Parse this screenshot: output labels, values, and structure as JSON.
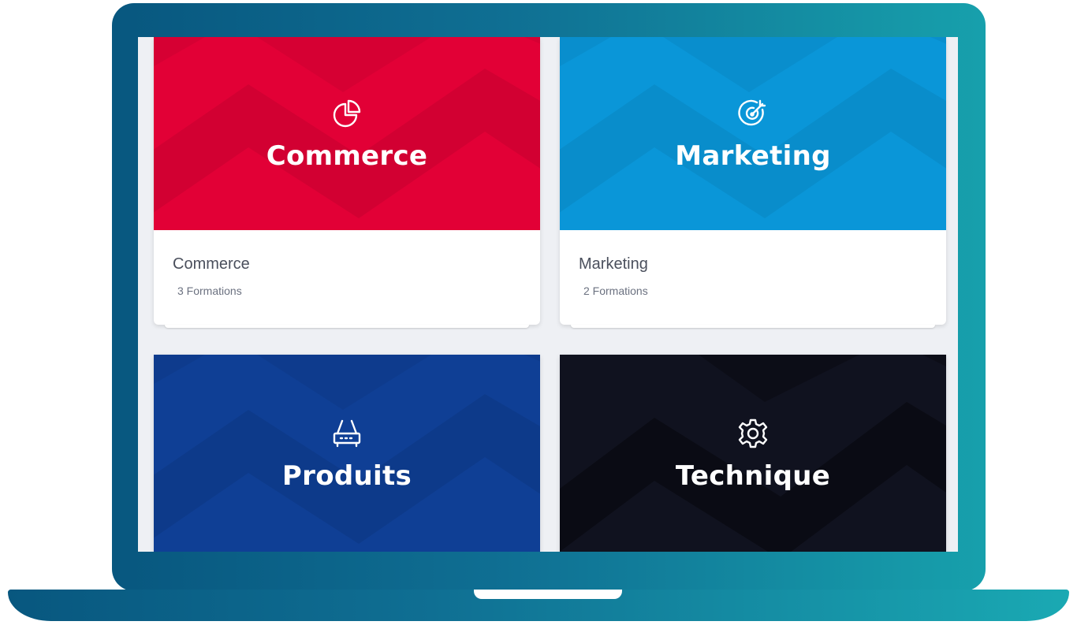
{
  "colors": {
    "commerce": "#e20036",
    "marketing": "#0a96d8",
    "produits": "#0f3f95",
    "technique": "#10121f",
    "screen_background": "#eef0f4",
    "bezel": "#0f6f93"
  },
  "categories": [
    {
      "id": "commerce",
      "banner_title": "Commerce",
      "icon": "pie-chart-icon",
      "name": "Commerce",
      "count": "3 Formations"
    },
    {
      "id": "marketing",
      "banner_title": "Marketing",
      "icon": "target-icon",
      "name": "Marketing",
      "count": "2 Formations"
    },
    {
      "id": "produits",
      "banner_title": "Produits",
      "icon": "router-icon"
    },
    {
      "id": "technique",
      "banner_title": "Technique",
      "icon": "gear-icon"
    }
  ]
}
